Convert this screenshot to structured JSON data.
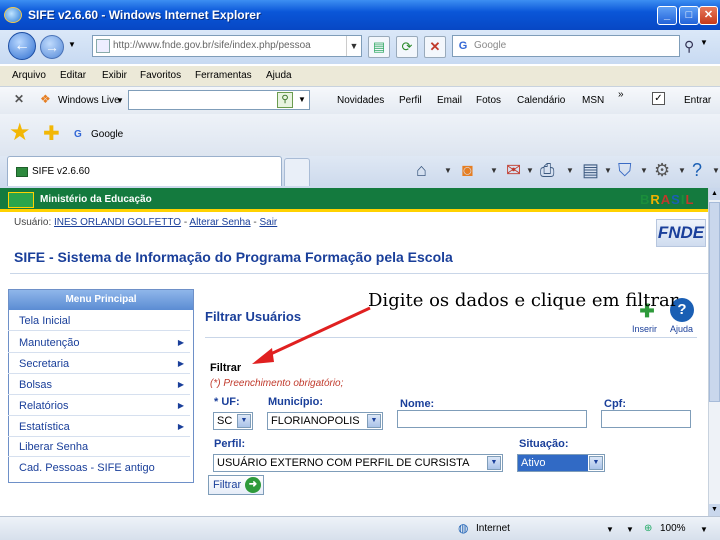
{
  "window": {
    "title": "SIFE v2.6.60 - Windows Internet Explorer"
  },
  "address": {
    "url": "http://www.fnde.gov.br/sife/index.php/pessoa",
    "search_placeholder": "Google"
  },
  "menubar": [
    "Arquivo",
    "Editar",
    "Exibir",
    "Favoritos",
    "Ferramentas",
    "Ajuda"
  ],
  "livebar": {
    "brand": "Windows Live",
    "links": [
      "Novidades",
      "Perfil",
      "Email",
      "Fotos",
      "Calendário",
      "MSN"
    ],
    "more": "»",
    "signin": "Entrar"
  },
  "favorites": {
    "google_label": "Google"
  },
  "tab": {
    "label": "SIFE v2.6.60"
  },
  "header": {
    "ministry": "Ministério da Educação",
    "brasil": "BRASIL",
    "user_prefix": "Usuário: ",
    "user_name": "INES ORLANDI GOLFETTO",
    "dash1": " - ",
    "alter_password": "Alterar Senha",
    "dash2": " - ",
    "logout": "Sair",
    "fnde": "FNDE",
    "system_title": "SIFE - Sistema de Informação do Programa Formação pela Escola"
  },
  "menu": {
    "title": "Menu Principal",
    "items": [
      {
        "label": "Tela Inicial",
        "arrow": ""
      },
      {
        "label": "Manutenção",
        "arrow": "▶"
      },
      {
        "label": "Secretaria",
        "arrow": "▶"
      },
      {
        "label": "Bolsas",
        "arrow": "▶"
      },
      {
        "label": "Relatórios",
        "arrow": "▶"
      },
      {
        "label": "Estatística",
        "arrow": "▶"
      },
      {
        "label": "Liberar Senha",
        "arrow": ""
      },
      {
        "label": "Cad. Pessoas - SIFE antigo",
        "arrow": ""
      }
    ]
  },
  "panel": {
    "title": "Filtrar Usuários",
    "insert_label": "Inserir",
    "help_label": "Ajuda",
    "legend": "Filtrar",
    "required_note": "(*) Preenchimento obrigatório;",
    "uf_label": "* UF:",
    "uf_value": "SC",
    "municipio_label": "Município:",
    "municipio_value": "FLORIANOPOLIS",
    "nome_label": "Nome:",
    "cpf_label": "Cpf:",
    "perfil_label": "Perfil:",
    "perfil_value": "USUÁRIO EXTERNO COM PERFIL DE CURSISTA",
    "situacao_label": "Situação:",
    "situacao_value": "Ativo",
    "filter_button": "Filtrar"
  },
  "status": {
    "zone": "Internet",
    "zoom": "100%"
  },
  "annotation": {
    "text": "Digite os dados e clique em filtrar",
    "color": "#e02020"
  }
}
